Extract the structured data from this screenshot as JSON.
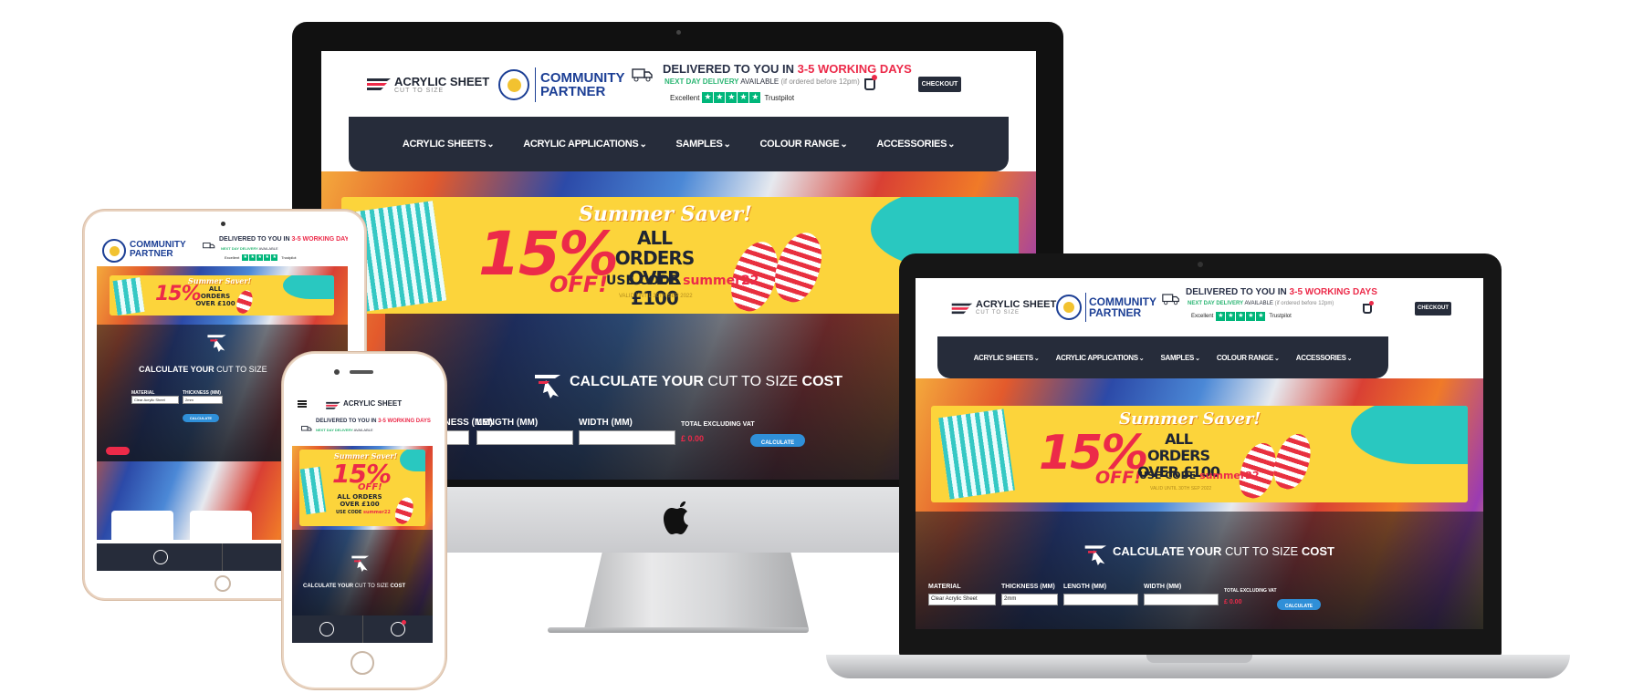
{
  "brand": {
    "name": "ACRYLIC SHEET",
    "tagline": "CUT TO SIZE",
    "partner_line1": "COMMUNITY",
    "partner_line2": "PARTNER"
  },
  "delivery": {
    "prefix": "DELIVERED TO YOU IN ",
    "days": "3-5 WORKING DAYS",
    "nextday_label": "NEXT DAY DELIVERY",
    "nextday_suffix": " AVAILABLE ",
    "nextday_note": "(if ordered before 12pm)"
  },
  "trustpilot": {
    "rating_label": "Excellent",
    "brand": "Trustpilot"
  },
  "header": {
    "checkout_label": "CHECKOUT"
  },
  "nav": {
    "items": [
      {
        "label": "ACRYLIC SHEETS"
      },
      {
        "label": "ACRYLIC APPLICATIONS"
      },
      {
        "label": "SAMPLES"
      },
      {
        "label": "COLOUR RANGE"
      },
      {
        "label": "ACCESSORIES"
      }
    ]
  },
  "promo": {
    "headline": "Summer Saver!",
    "percent": "15%",
    "off": "OFF!",
    "orders_line1": "ALL ORDERS",
    "orders_line2": "OVER £100",
    "code_prefix": "USE CODE ",
    "code": "summer22",
    "valid": "VALID UNTIL 30TH SEP 2022"
  },
  "calculator": {
    "title_pre": "CALCULATE YOUR ",
    "title_mid": "CUT TO SIZE ",
    "title_end": "COST",
    "material_label": "MATERIAL",
    "thickness_label": "THICKNESS (MM)",
    "length_label": "LENGTH (MM)",
    "width_label": "WIDTH (MM)",
    "total_label": "TOTAL EXCLUDING VAT",
    "material_value": "Clear Acrylic Sheet",
    "thickness_value": "2mm",
    "price": "£ 0.00",
    "button_label": "CALCULATE"
  },
  "colors": {
    "navy": "#262c3a",
    "accent_red": "#ec2a49",
    "promo_yellow": "#fcd43b",
    "trust_green": "#00b67a",
    "button_blue": "#2f8fd8"
  },
  "icons": [
    "truck-icon",
    "cart-icon",
    "user-icon",
    "menu-icon",
    "apple-logo-icon",
    "star-logo-icon"
  ]
}
